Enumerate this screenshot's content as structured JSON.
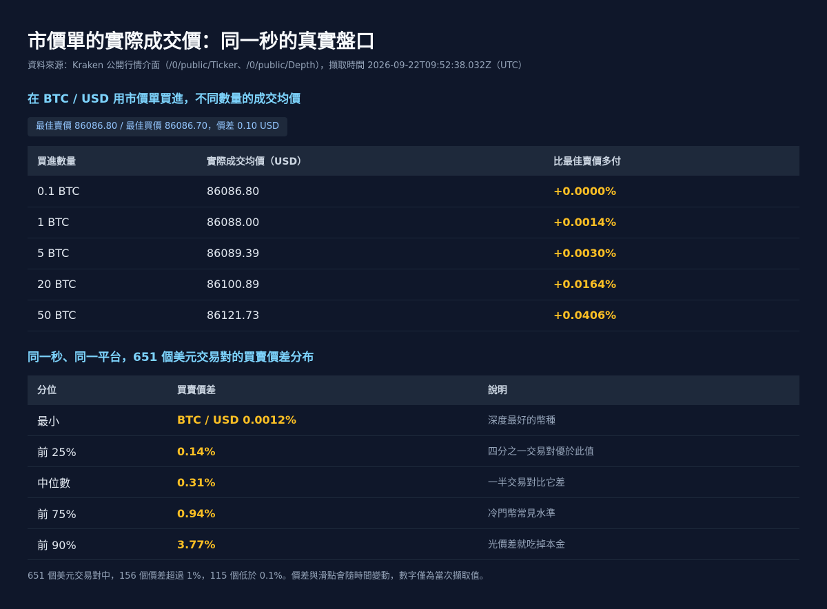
{
  "header": {
    "title": "市價單的實際成交價：同一秒的真實盤口",
    "subtitle": "資料來源：Kraken 公開行情介面（/0/public/Ticker、/0/public/Depth），擷取時間 2026-09-22T09:52:38.032Z（UTC）"
  },
  "section1": {
    "title": "在 BTC / USD 用市價單買進，不同數量的成交均價",
    "badge": "最佳賣價 86086.80 / 最佳買價 86086.70，價差 0.10 USD",
    "columns": [
      "買進數量",
      "實際成交均價（USD）",
      "比最佳賣價多付"
    ],
    "rows": [
      [
        "0.1 BTC",
        "86086.80",
        "+0.0000%"
      ],
      [
        "1 BTC",
        "86088.00",
        "+0.0014%"
      ],
      [
        "5 BTC",
        "86089.39",
        "+0.0030%"
      ],
      [
        "20 BTC",
        "86100.89",
        "+0.0164%"
      ],
      [
        "50 BTC",
        "86121.73",
        "+0.0406%"
      ]
    ]
  },
  "section2": {
    "title": "同一秒、同一平台，651 個美元交易對的買賣價差分布",
    "columns": [
      "分位",
      "買賣價差",
      "說明"
    ],
    "rows": [
      [
        "最小",
        "BTC / USD 0.0012%",
        "深度最好的幣種"
      ],
      [
        "前 25%",
        "0.14%",
        "四分之一交易對優於此值"
      ],
      [
        "中位數",
        "0.31%",
        "一半交易對比它差"
      ],
      [
        "前 75%",
        "0.94%",
        "冷門幣常見水準"
      ],
      [
        "前 90%",
        "3.77%",
        "光價差就吃掉本金"
      ]
    ]
  },
  "footer": {
    "note": "651 個美元交易對中，156 個價差超過 1%，115 個低於 0.1%。價差與滑點會隨時間變動，數字僅為當次擷取值。"
  },
  "colors": {
    "background": "#0f172a",
    "header_row": "#1e293b",
    "accent_blue": "#7dd3fc",
    "highlight_amber": "#fbbf24"
  }
}
